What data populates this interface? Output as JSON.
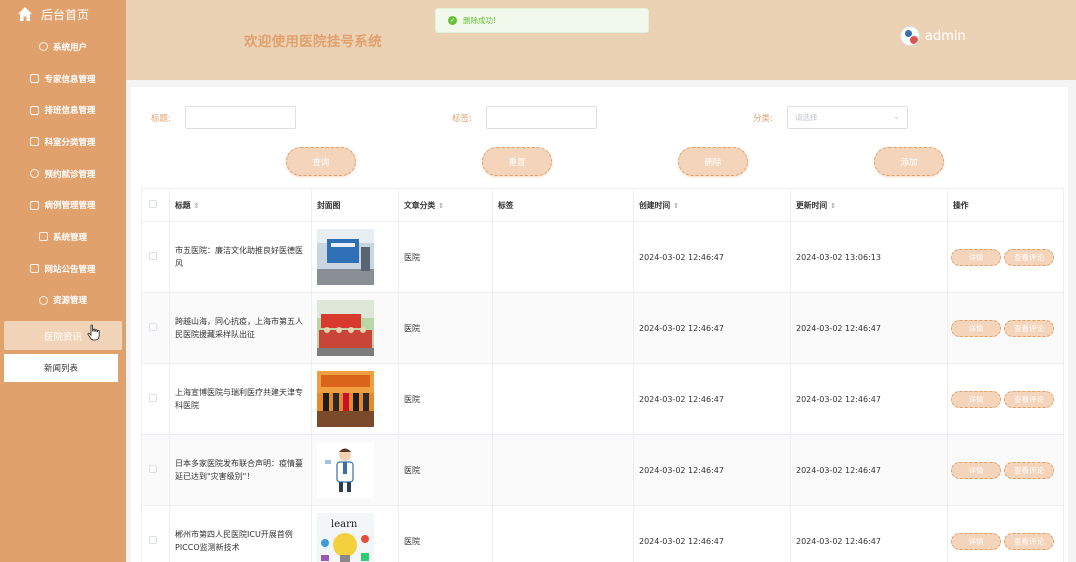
{
  "sidebar": {
    "home_label": "后台首页",
    "items": [
      {
        "label": "系统用户",
        "icon": "cloud-icon"
      },
      {
        "label": "专家信息管理",
        "icon": "edit-icon"
      },
      {
        "label": "排班信息管理",
        "icon": "edit-icon"
      },
      {
        "label": "科室分类管理",
        "icon": "edit-icon"
      },
      {
        "label": "预约就诊管理",
        "icon": "cloud-icon"
      },
      {
        "label": "病例管理管理",
        "icon": "edit-icon"
      },
      {
        "label": "系统管理",
        "icon": "grid-icon"
      },
      {
        "label": "网站公告管理",
        "icon": "edit-icon"
      },
      {
        "label": "资源管理",
        "icon": "cloud-icon"
      }
    ],
    "active_item": "医院资讯",
    "submenu_item": "新闻列表"
  },
  "header": {
    "title": "欢迎使用医院挂号系统",
    "username": "admin"
  },
  "toast": {
    "message": "删除成功!"
  },
  "search": {
    "title_label": "标题:",
    "tag_label": "标签:",
    "category_label": "分类:",
    "category_placeholder": "请选择"
  },
  "buttons": {
    "query": "查询",
    "reset": "重置",
    "delete": "删除",
    "add": "添加"
  },
  "table": {
    "headers": {
      "title": "标题",
      "cover": "封面图",
      "category": "文章分类",
      "tag": "标签",
      "created": "创建时间",
      "updated": "更新时间",
      "actions": "操作"
    },
    "action_labels": {
      "detail": "详情",
      "comments": "查看评论"
    },
    "rows": [
      {
        "title": "市五医院：廉洁文化助推良好医德医风",
        "category": "医院",
        "tag": "",
        "created": "2024-03-02 12:46:47",
        "updated": "2024-03-02 13:06:13"
      },
      {
        "title": "跨越山海，同心抗疫，上海市第五人民医院援藏采样队出征",
        "category": "医院",
        "tag": "",
        "created": "2024-03-02 12:46:47",
        "updated": "2024-03-02 12:46:47"
      },
      {
        "title": "上海宣博医院与瑞利医疗共建天津专科医院",
        "category": "医院",
        "tag": "",
        "created": "2024-03-02 12:46:47",
        "updated": "2024-03-02 12:46:47"
      },
      {
        "title": "日本多家医院发布联合声明：疫情蔓延已达到\"灾害级别\"！",
        "category": "医院",
        "tag": "",
        "created": "2024-03-02 12:46:47",
        "updated": "2024-03-02 12:46:47"
      },
      {
        "title": "郴州市第四人民医院ICU开展首例PICCO监测新技术",
        "category": "医院",
        "tag": "",
        "created": "2024-03-02 12:46:47",
        "updated": "2024-03-02 12:46:47"
      }
    ]
  },
  "colors": {
    "accent": "#e0a16d",
    "header_bg": "#ecd2b5",
    "button_bg": "#f4d4bb",
    "toast_green": "#67c23a"
  }
}
